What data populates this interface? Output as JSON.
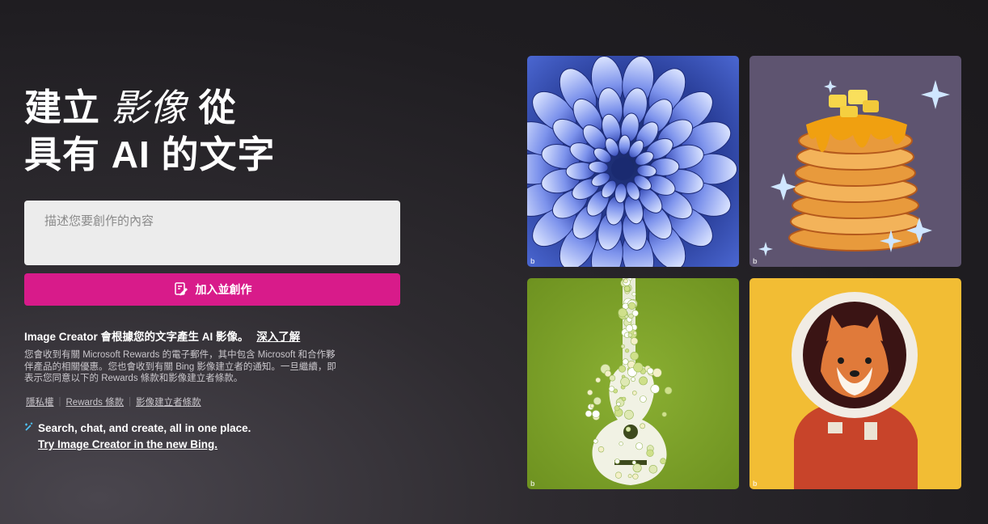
{
  "hero": {
    "line1_a": "建立",
    "line1_accent": "影像",
    "line1_b": "從",
    "line2": "具有 AI 的文字"
  },
  "prompt": {
    "placeholder": "描述您要創作的內容"
  },
  "create_button": {
    "label": "加入並創作",
    "icon": "join-create-icon",
    "color": "#d81b8a"
  },
  "info": {
    "text": "Image Creator 會根據您的文字產生 AI 影像。",
    "learn_more": "深入了解"
  },
  "disclaimer": "您會收到有關 Microsoft Rewards 的電子郵件，其中包含 Microsoft 和合作夥伴產品的相關優惠。您也會收到有關 Bing 影像建立者的通知。一旦繼續，即表示您同意以下的 Rewards 條款和影像建立者條款。",
  "legal_links": [
    "隱私權",
    "Rewards 條款",
    "影像建立者條款"
  ],
  "promo": {
    "icon": "sparkle-icon",
    "text": "Search, chat, and create, all in one place.",
    "link": "Try Image Creator in the new Bing."
  },
  "gallery": [
    {
      "name": "blue-dahlia",
      "mark": "b"
    },
    {
      "name": "pancake-stack",
      "mark": "b"
    },
    {
      "name": "flower-guitar",
      "mark": "b"
    },
    {
      "name": "shiba-astronaut",
      "mark": "b"
    }
  ],
  "colors": {
    "accent": "#d81b8a",
    "background": "#2e2b30"
  }
}
